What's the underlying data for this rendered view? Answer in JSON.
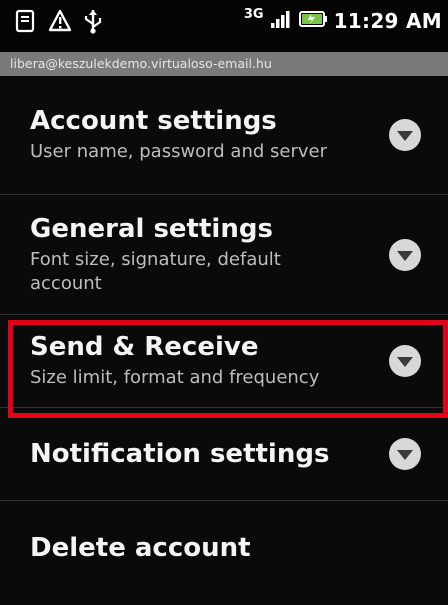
{
  "status_bar": {
    "network": "3G",
    "time": "11:29 AM",
    "icons": [
      "missed-call-icon",
      "alert-icon",
      "usb-icon",
      "signal-icon",
      "battery-icon"
    ]
  },
  "account_email": "libera@keszulekdemo.virtualoso-email.hu",
  "settings": [
    {
      "title": "Account settings",
      "subtitle": "User name, password and server"
    },
    {
      "title": "General settings",
      "subtitle": "Font size, signature, default account"
    },
    {
      "title": "Send & Receive",
      "subtitle": "Size limit, format and frequency"
    },
    {
      "title": "Notification settings",
      "subtitle": ""
    },
    {
      "title": "Delete account",
      "subtitle": ""
    }
  ],
  "highlight_color": "#e0001b"
}
